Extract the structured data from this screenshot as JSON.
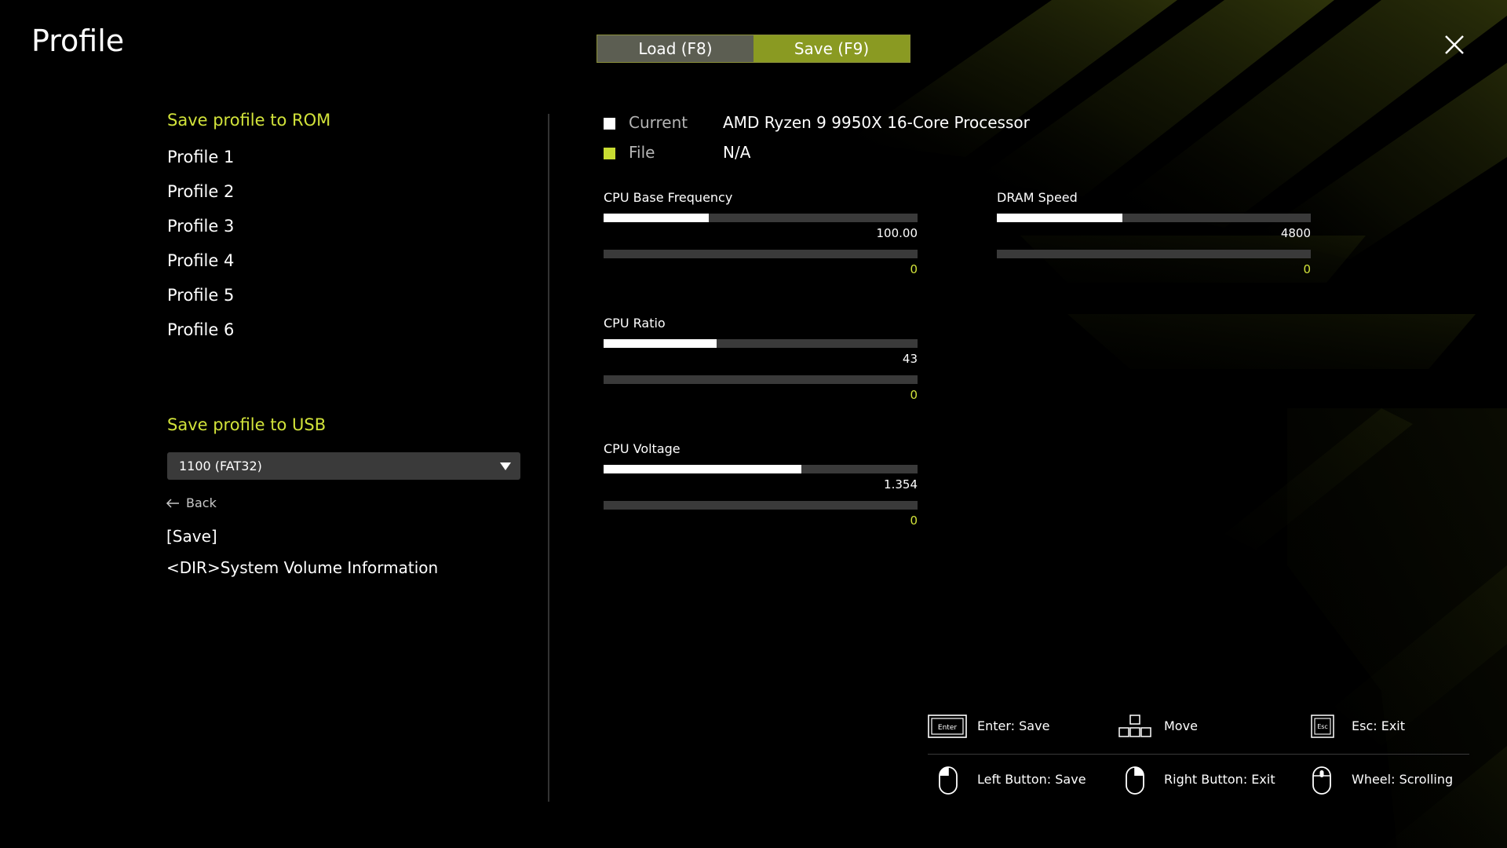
{
  "title": "Profile",
  "tabs": {
    "load": "Load (F8)",
    "save": "Save (F9)"
  },
  "rom": {
    "heading": "Save profile to ROM",
    "profiles": [
      "Profile 1",
      "Profile 2",
      "Profile 3",
      "Profile 4",
      "Profile 5",
      "Profile 6"
    ]
  },
  "usb": {
    "heading": "Save profile to USB",
    "drive": "1100 (FAT32)",
    "back_label": "Back",
    "files": [
      "[Save]",
      "<DIR>System Volume Information"
    ]
  },
  "legend": {
    "current_label": "Current",
    "current_value": "AMD Ryzen 9 9950X 16-Core Processor",
    "file_label": "File",
    "file_value": "N/A",
    "current_color": "#ffffff",
    "file_color": "#c8dc32"
  },
  "metrics": {
    "cpu_base_freq": {
      "label": "CPU Base Frequency",
      "current": "100.00",
      "file": "0",
      "current_fill": 0.335
    },
    "dram_speed": {
      "label": "DRAM Speed",
      "current": "4800",
      "file": "0",
      "current_fill": 0.4
    },
    "cpu_ratio": {
      "label": "CPU Ratio",
      "current": "43",
      "file": "0",
      "current_fill": 0.36
    },
    "cpu_voltage": {
      "label": "CPU Voltage",
      "current": "1.354",
      "file": "0",
      "current_fill": 0.63
    }
  },
  "help": {
    "enter": "Enter: Save",
    "move": "Move",
    "esc": "Esc: Exit",
    "left_button": "Left Button: Save",
    "right_button": "Right Button: Exit",
    "wheel": "Wheel: Scrolling",
    "enter_key_text": "Enter",
    "esc_key_text": "Esc"
  },
  "colors": {
    "accent": "#d2e33a",
    "save_tab": "#8a9a22",
    "load_tab": "#5c5e52"
  }
}
